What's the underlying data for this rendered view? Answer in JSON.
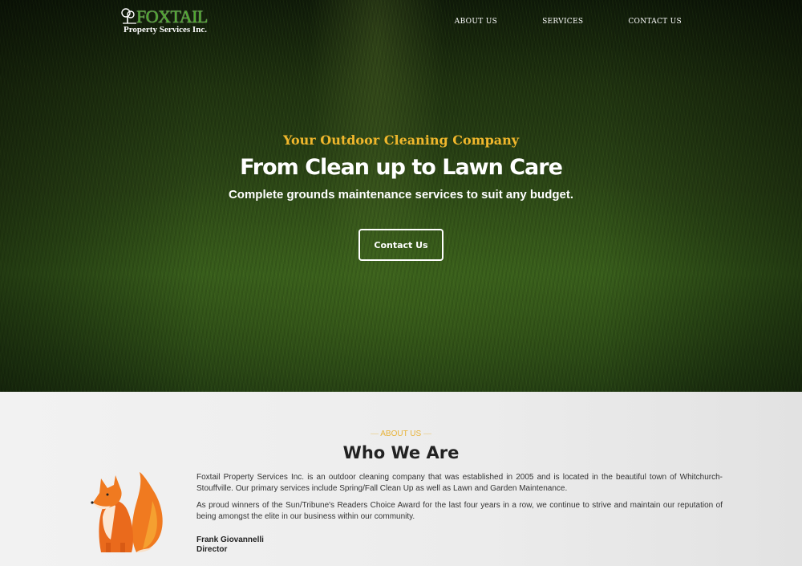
{
  "brand": {
    "name": "FOXTAIL",
    "subtitle": "Property Services Inc."
  },
  "nav": {
    "items": [
      "ABOUT US",
      "SERVICES",
      "CONTACT US"
    ]
  },
  "hero": {
    "tagline": "Your Outdoor Cleaning Company",
    "headline": "From Clean up to Lawn Care",
    "subheadline": "Complete grounds maintenance services to suit any budget.",
    "cta_label": "Contact Us"
  },
  "about": {
    "eyebrow": "ABOUT US",
    "title": "Who We Are",
    "paragraph1": "Foxtail Property Services Inc. is an outdoor cleaning company that was established in 2005 and is located in the beautiful town of Whitchurch-Stouffville. Our primary services include Spring/Fall Clean Up as well as Lawn and Garden Maintenance.",
    "paragraph2": "As proud winners of the Sun/Tribune's Readers Choice Award for the last four years in a row, we continue to strive and maintain our reputation of being amongst the elite in our business within our community.",
    "signature_name": "Frank Giovannelli",
    "signature_role": "Director"
  },
  "colors": {
    "accent": "#f0b72c",
    "brand_green": "#4caa2a",
    "fox_orange": "#f07a20"
  },
  "icons": {
    "logo": "tree-logo-icon",
    "mascot": "fox-illustration"
  }
}
